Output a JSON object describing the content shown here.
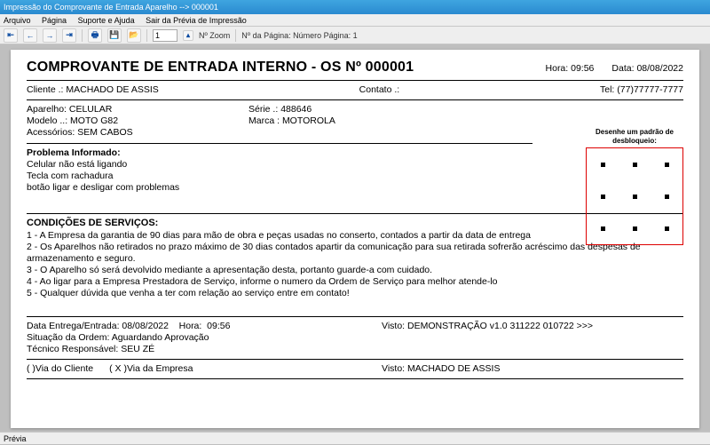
{
  "titlebar": {
    "main": "Impressão do Comprovante de Entrada Aparelho --> 000001",
    "faded": "   "
  },
  "menu": {
    "arquivo": "Arquivo",
    "pagina": "Página",
    "suporte": "Suporte e Ajuda",
    "sair": "Sair da Prévia de Impressão"
  },
  "toolbar": {
    "zoom_value": "1",
    "zoom_lbl": "Nº Zoom",
    "page_lbl": "Nº da Página: Número Página: 1"
  },
  "doc": {
    "title": "COMPROVANTE DE ENTRADA INTERNO - OS Nº 000001",
    "hora_lbl": "Hora:",
    "hora": "09:56",
    "data_lbl": "Data:",
    "data": "08/08/2022",
    "cliente_lbl": "Cliente   .:",
    "cliente": "MACHADO DE ASSIS",
    "contato_lbl": "Contato .:",
    "tel_lbl": "Tel:",
    "tel": "(77)77777-7777",
    "aparelho_lbl": "Aparelho:",
    "aparelho": "CELULAR",
    "serie_lbl": "Série  .:",
    "serie": "488646",
    "modelo_lbl": "Modelo ..:",
    "modelo": "MOTO G82",
    "marca_lbl": "Marca :",
    "marca": "MOTOROLA",
    "acess_lbl": "Acessórios:",
    "acess": "SEM CABOS",
    "unlock_lbl": "Desenhe um padrão de desbloqueio:",
    "prob_title": "Problema Informado:",
    "prob1": "Celular não está ligando",
    "prob2": "Tecla com rachadura",
    "prob3": "botão ligar e desligar com problemas",
    "cond_title": "CONDIÇÕES DE SERVIÇOS:",
    "cond1": "1 - A Empresa da garantia de 90 dias para mão de obra e peças usadas no conserto, contados  a partir da data de entrega",
    "cond2": "2 - Os Aparelhos não retirados no prazo máximo de 30 dias contados apartir da comunicação para sua retirada sofrerão acréscimo das despesas de armazenamento e seguro.",
    "cond3": "3 - O Aparelho só será devolvido mediante a apresentação desta, portanto guarde-a com cuidado.",
    "cond4": "4 - Ao ligar para a Empresa Prestadora de Serviço, informe o numero da Ordem de Serviço para melhor atende-lo",
    "cond5": "5 - Qualquer dúvida que venha a ter com relação ao serviço entre em contato!",
    "entrega_lbl": "Data Entrega/Entrada:",
    "entrega_data": "08/08/2022",
    "entrega_hora_lbl": "Hora:",
    "entrega_hora": "09:56",
    "visto1_lbl": "Visto:",
    "visto1": "DEMONSTRAÇÃO v1.0 311222 010722 >>>",
    "situacao_lbl": "Situação da Ordem:",
    "situacao": "Aguardando Aprovação",
    "tecnico_lbl": "Técnico Responsável:",
    "tecnico": "SEU ZÉ",
    "via_cliente": "(    )Via do Cliente",
    "via_empresa": "( X )Via da Empresa",
    "visto2_lbl": "Visto:",
    "visto2": "MACHADO DE ASSIS"
  },
  "status": {
    "text": "Prévia"
  }
}
